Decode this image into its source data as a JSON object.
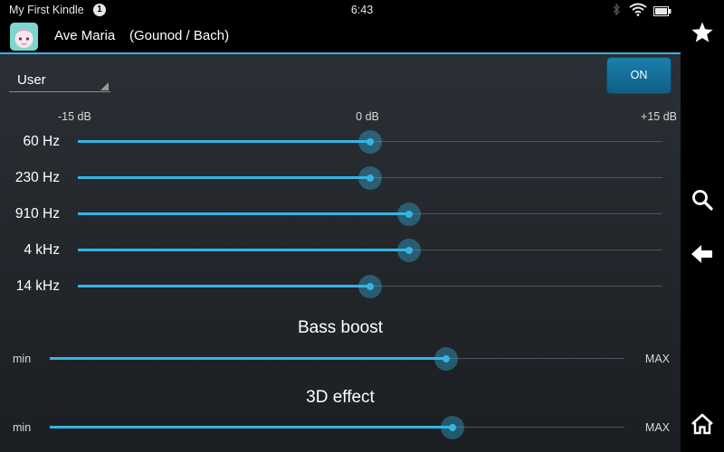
{
  "status_bar": {
    "device_name": "My First Kindle",
    "notification_count": "1",
    "time": "6:43",
    "icons": [
      "bluetooth-icon",
      "wifi-icon",
      "battery-icon"
    ]
  },
  "title_bar": {
    "app_icon": "app-icon",
    "track_title": "Ave Maria",
    "track_artist": "(Gounod / Bach)"
  },
  "equalizer": {
    "preset": "User",
    "toggle_label": "ON",
    "scale": {
      "min": "-15 dB",
      "mid": "0 dB",
      "max": "+15 dB"
    },
    "bands": [
      {
        "label": "60 Hz",
        "gain_db": 0
      },
      {
        "label": "230 Hz",
        "gain_db": 0
      },
      {
        "label": "910 Hz",
        "gain_db": 2
      },
      {
        "label": "4 kHz",
        "gain_db": 2
      },
      {
        "label": "14 kHz",
        "gain_db": 0
      }
    ]
  },
  "effects": [
    {
      "title": "Bass boost",
      "min_label": "min",
      "max_label": "MAX",
      "level": 0.69
    },
    {
      "title": "3D effect",
      "min_label": "min",
      "max_label": "MAX",
      "level": 0.7
    }
  ],
  "navigation": {
    "items": [
      "star-icon",
      "search-icon",
      "back-arrow-icon",
      "home-icon"
    ]
  },
  "colors": {
    "accent": "#33b5e5",
    "panel_top": "#2b3036",
    "panel_bottom": "#1b1e22",
    "toggle": "#1473a0"
  }
}
